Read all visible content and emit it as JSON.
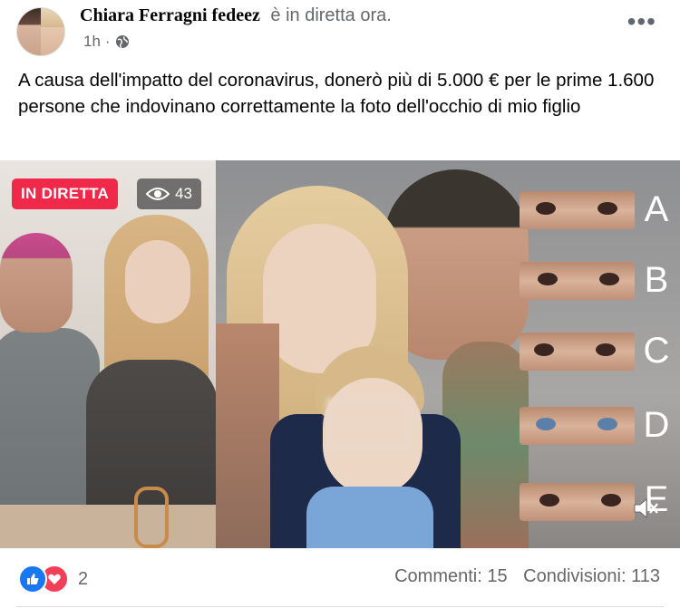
{
  "header": {
    "author": "Chiara Ferragni fedeez",
    "status_text": "è in diretta ora.",
    "time": "1h",
    "separator": "·",
    "privacy_icon": "globe-icon",
    "more_label": "•••"
  },
  "post": {
    "text": "A causa dell'impatto del coronavirus, donerò più di 5.000 € per le prime 1.600 persone che indovinano correttamente la foto dell'occhio di mio figlio"
  },
  "media": {
    "live_badge": "IN DIRETTA",
    "viewer_count": "43",
    "viewer_icon": "eye-icon",
    "options": [
      {
        "letter": "A",
        "eye_color": "#3a2520"
      },
      {
        "letter": "B",
        "eye_color": "#3a2520"
      },
      {
        "letter": "C",
        "eye_color": "#3a2520"
      },
      {
        "letter": "D",
        "eye_color": "#5b7fa8"
      },
      {
        "letter": "E",
        "eye_color": "#3a2520"
      }
    ],
    "mute_icon": "speaker-muted-icon"
  },
  "footer": {
    "reaction_icons": [
      "like-icon",
      "love-icon"
    ],
    "reaction_count": "2",
    "comments": "Commenti: 15",
    "shares": "Condivisioni: 113"
  },
  "colors": {
    "live_red": "#f0284a",
    "like_blue": "#1877f2",
    "love_red": "#f33e58",
    "secondary_text": "#65676b"
  }
}
